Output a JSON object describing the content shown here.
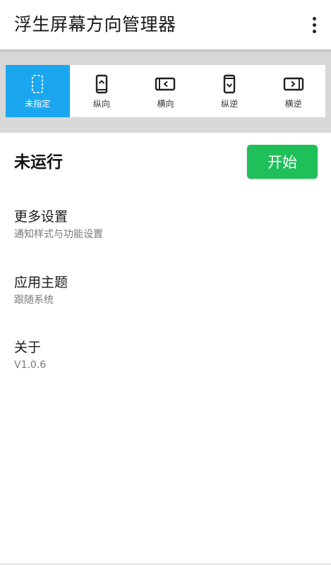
{
  "appbar": {
    "title": "浮生屏幕方向管理器",
    "overflow_icon": "more-vert-icon"
  },
  "orientation": {
    "selected_color": "#1aa7f0",
    "items": [
      {
        "label": "未指定",
        "icon": "unspecified-icon",
        "selected": true
      },
      {
        "label": "纵向",
        "icon": "portrait-icon",
        "selected": false
      },
      {
        "label": "横向",
        "icon": "landscape-icon",
        "selected": false
      },
      {
        "label": "纵逆",
        "icon": "reverse-portrait-icon",
        "selected": false
      },
      {
        "label": "横逆",
        "icon": "reverse-landscape-icon",
        "selected": false
      }
    ]
  },
  "service": {
    "status": "未运行",
    "start_label": "开始",
    "start_color": "#1fbf5a"
  },
  "settings": [
    {
      "title": "更多设置",
      "subtitle": "通知样式与功能设置"
    },
    {
      "title": "应用主题",
      "subtitle": "跟随系统"
    },
    {
      "title": "关于",
      "subtitle": "V1.0.6"
    }
  ]
}
